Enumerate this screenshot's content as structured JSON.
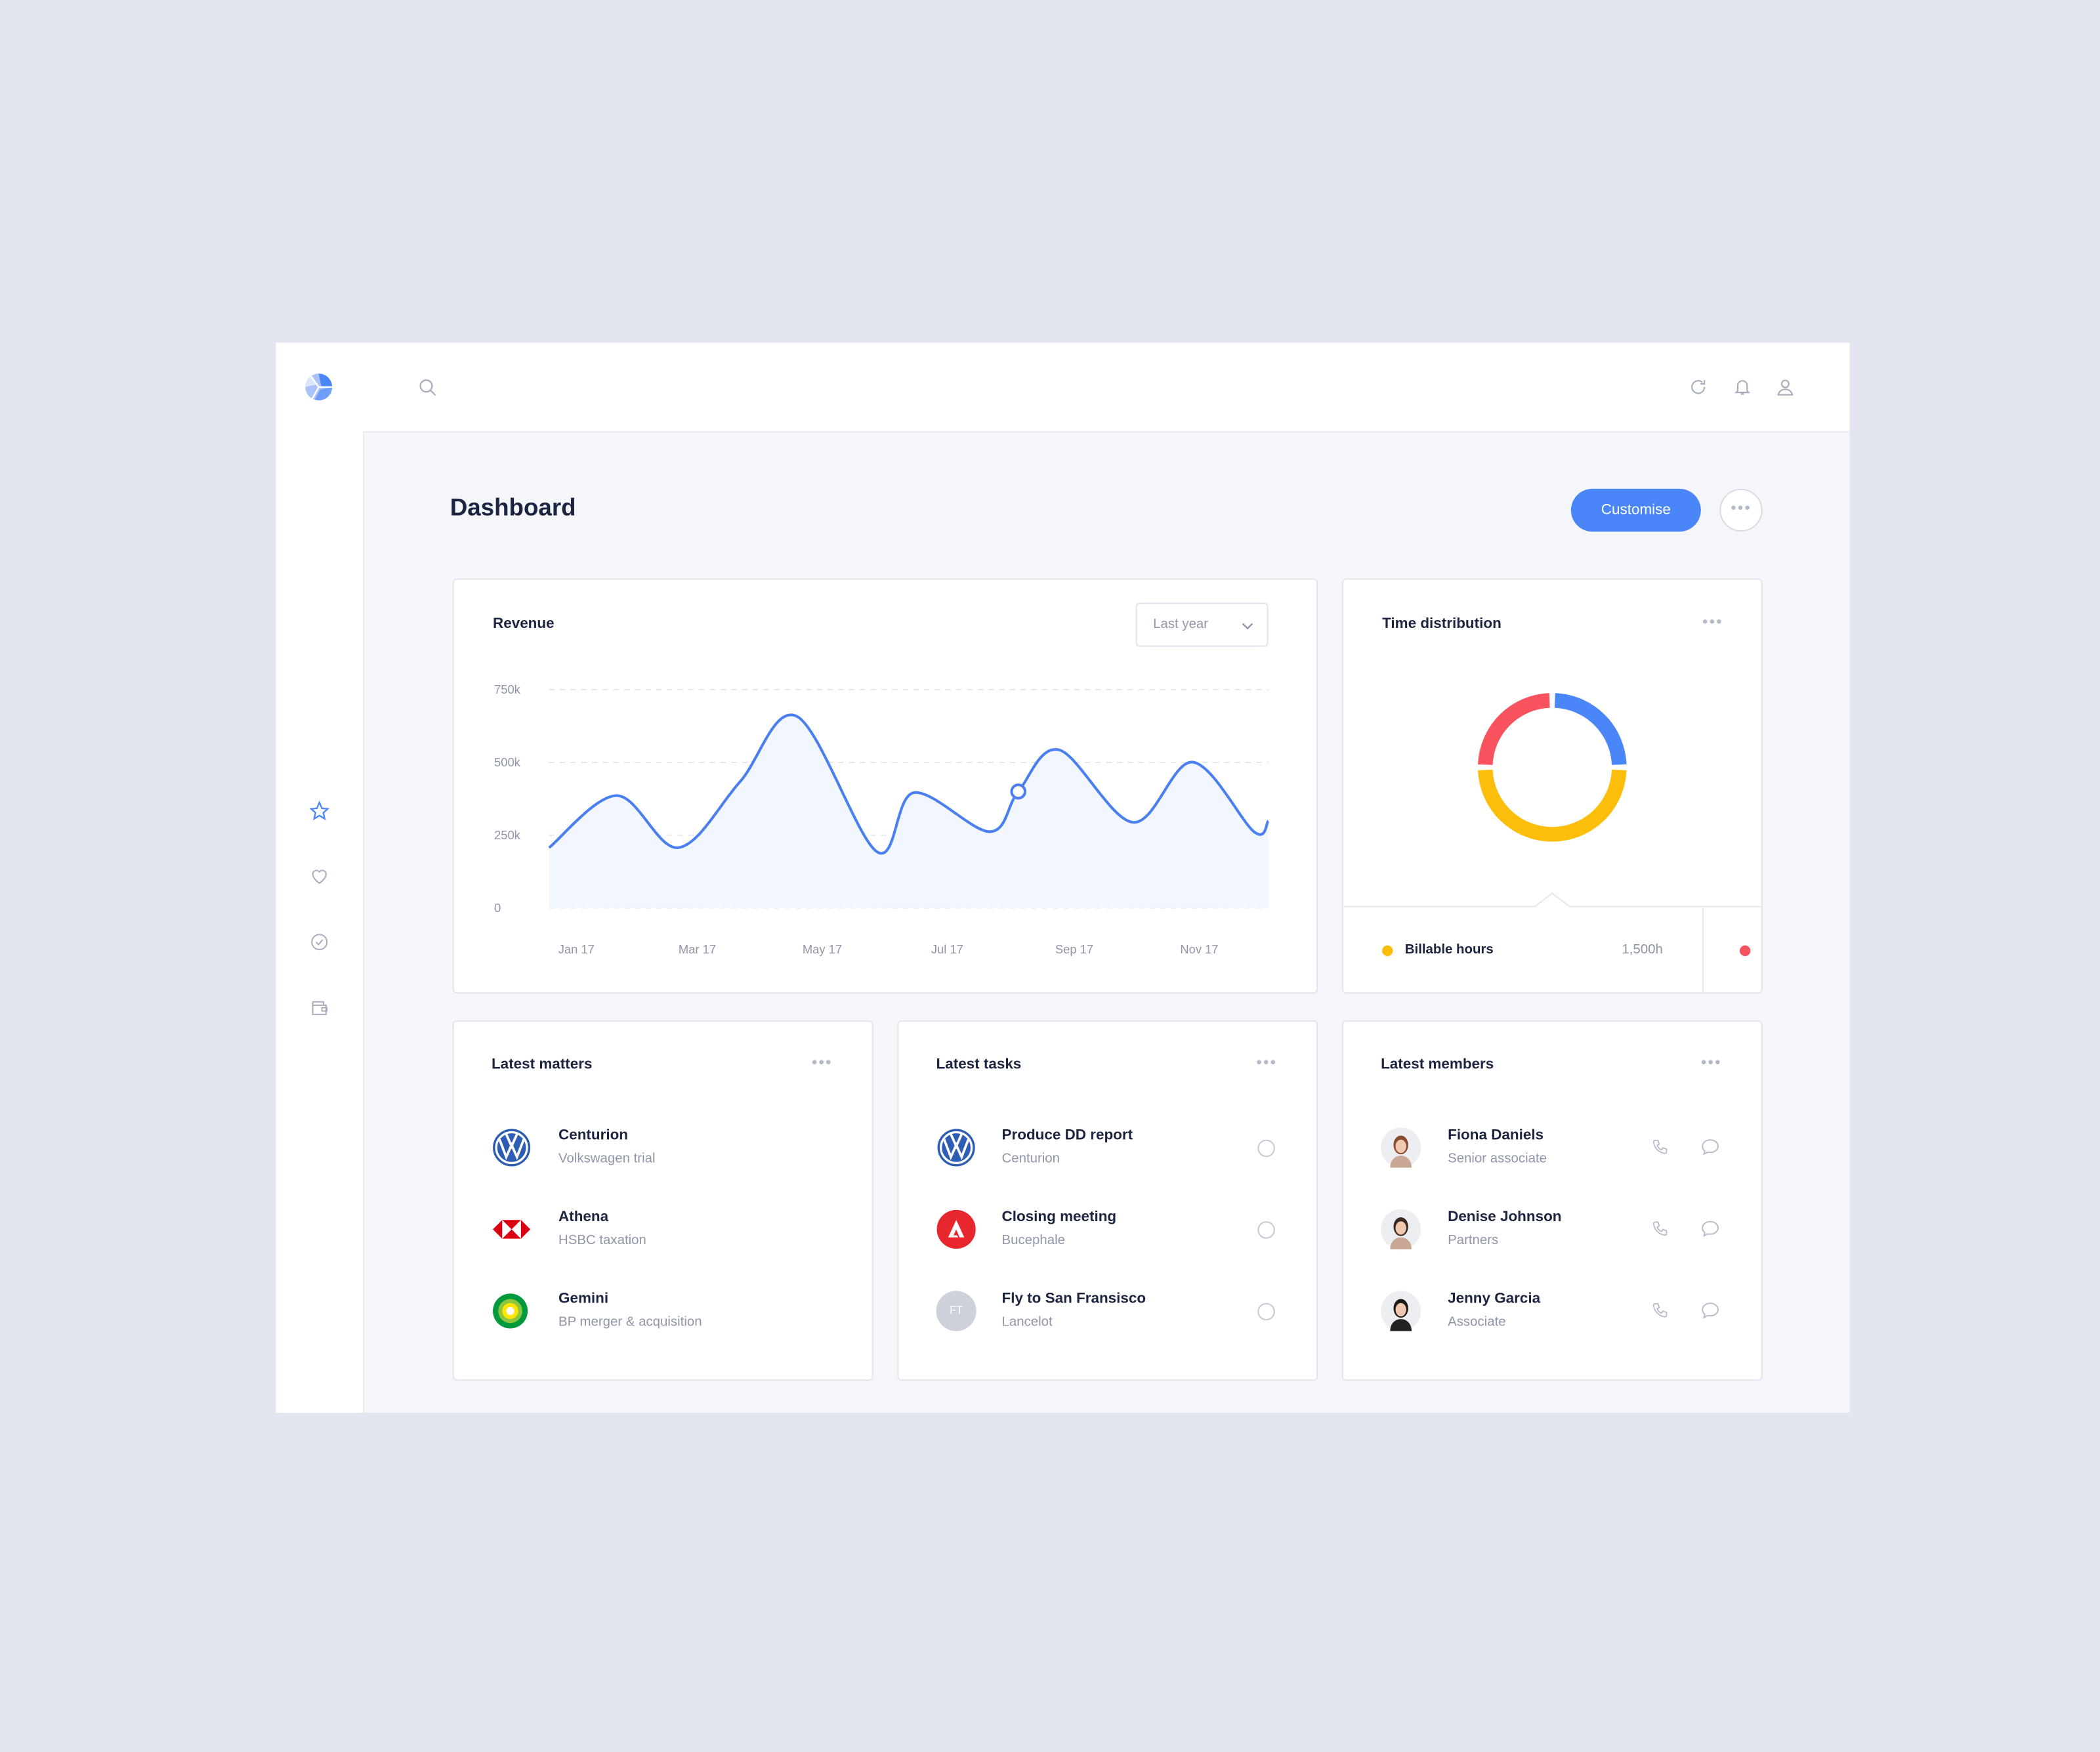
{
  "page": {
    "title": "Dashboard",
    "customise_label": "Customise",
    "more_icon": "ellipsis-icon"
  },
  "colors": {
    "accent": "#4a86f7",
    "background": "#e3e6ee",
    "yellow": "#fdbe0b",
    "red": "#f9525f",
    "blue": "#4a86f7"
  },
  "topbar": {
    "icons": [
      "search-icon",
      "refresh-icon",
      "bell-icon",
      "user-icon"
    ]
  },
  "sidebar": {
    "icons": [
      "logo",
      "star-icon",
      "heart-icon",
      "check-circle-icon",
      "wallet-icon"
    ],
    "active": "star-icon"
  },
  "revenue": {
    "title": "Revenue",
    "period": "Last year",
    "chart_data": {
      "type": "area",
      "y_ticks": [
        "0",
        "250k",
        "500k",
        "750k"
      ],
      "ylim": [
        0,
        750000
      ],
      "x_ticks": [
        "Jan 17",
        "Mar 17",
        "May 17",
        "Jul 17",
        "Sep 17",
        "Nov 17"
      ],
      "grid": true,
      "points": [
        {
          "x": "2016-12-20",
          "y": 207000
        },
        {
          "x": "2017-01-22",
          "y": 386000
        },
        {
          "x": "2017-02-21",
          "y": 207000
        },
        {
          "x": "2017-03-23",
          "y": 432000
        },
        {
          "x": "2017-04-20",
          "y": 658000
        },
        {
          "x": "2017-05-29",
          "y": 193000
        },
        {
          "x": "2017-06-16",
          "y": 396000
        },
        {
          "x": "2017-07-23",
          "y": 262000
        },
        {
          "x": "2017-08-06",
          "y": 400000
        },
        {
          "x": "2017-08-26",
          "y": 543000
        },
        {
          "x": "2017-10-01",
          "y": 294000
        },
        {
          "x": "2017-10-30",
          "y": 501000
        },
        {
          "x": "2017-11-29",
          "y": 262000
        },
        {
          "x": "2017-12-06",
          "y": 299000
        }
      ],
      "highlight": {
        "x": "2017-08-06",
        "y": 400000
      }
    }
  },
  "time_distribution": {
    "title": "Time distribution",
    "chart_data": {
      "type": "pie",
      "donut": true,
      "slices": [
        {
          "share": 0.25,
          "color": "#4a86f7"
        },
        {
          "share": 0.5,
          "color": "#fdbe0b"
        },
        {
          "share": 0.25,
          "color": "#f9525f"
        }
      ]
    },
    "legend": [
      {
        "label": "Billable hours",
        "value": "1,500h",
        "color": "#fdbe0b"
      },
      {
        "color": "#f9525f"
      }
    ]
  },
  "matters": {
    "title": "Latest matters",
    "items": [
      {
        "name": "Centurion",
        "sub": "Volkswagen trial",
        "logo": "volkswagen-logo"
      },
      {
        "name": "Athena",
        "sub": "HSBC taxation",
        "logo": "hsbc-logo"
      },
      {
        "name": "Gemini",
        "sub": "BP merger & acquisition",
        "logo": "bp-logo"
      }
    ]
  },
  "tasks": {
    "title": "Latest tasks",
    "items": [
      {
        "name": "Produce DD report",
        "sub": "Centurion",
        "logo": "volkswagen-logo"
      },
      {
        "name": "Closing meeting",
        "sub": "Bucephale",
        "logo": "adobe-logo"
      },
      {
        "name": "Fly to San Fransisco",
        "sub": "Lancelot",
        "initials": "FT"
      }
    ]
  },
  "members": {
    "title": "Latest members",
    "items": [
      {
        "name": "Fiona Daniels",
        "sub": "Senior associate"
      },
      {
        "name": "Denise Johnson",
        "sub": "Partners"
      },
      {
        "name": "Jenny Garcia",
        "sub": "Associate"
      }
    ]
  }
}
